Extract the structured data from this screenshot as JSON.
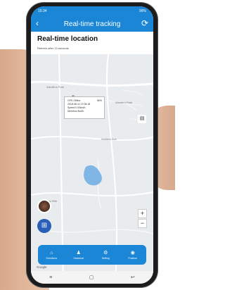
{
  "status": {
    "left": "15:34",
    "right": "99%"
  },
  "nav": {
    "title": "Real-time tracking",
    "back_icon": "back-arrow-icon",
    "refresh_icon": "refresh-icon"
  },
  "header": {
    "title": "Real-time location",
    "subtitle": "Refresh after 13 seconds"
  },
  "map": {
    "labels": [
      "Arbolitos Park",
      "Western Park",
      "Wallace Ave",
      "Rolling Hills"
    ]
  },
  "popup": {
    "battery": "56%",
    "lines": [
      "GPS Offline",
      "2018-08-11 07:08:18",
      "Speed:0.00km/h",
      "Direction:North"
    ]
  },
  "tabs": [
    {
      "label": "Directions",
      "icon": "directions-icon"
    },
    {
      "label": "Historical",
      "icon": "person-icon"
    },
    {
      "label": "Setting",
      "icon": "gear-icon"
    },
    {
      "label": "Position",
      "icon": "location-pin-icon"
    }
  ],
  "brand": {
    "google": "Google"
  },
  "colors": {
    "primary": "#1b86d6",
    "map_bg": "#e9ecef",
    "water": "#7fb6e6"
  }
}
